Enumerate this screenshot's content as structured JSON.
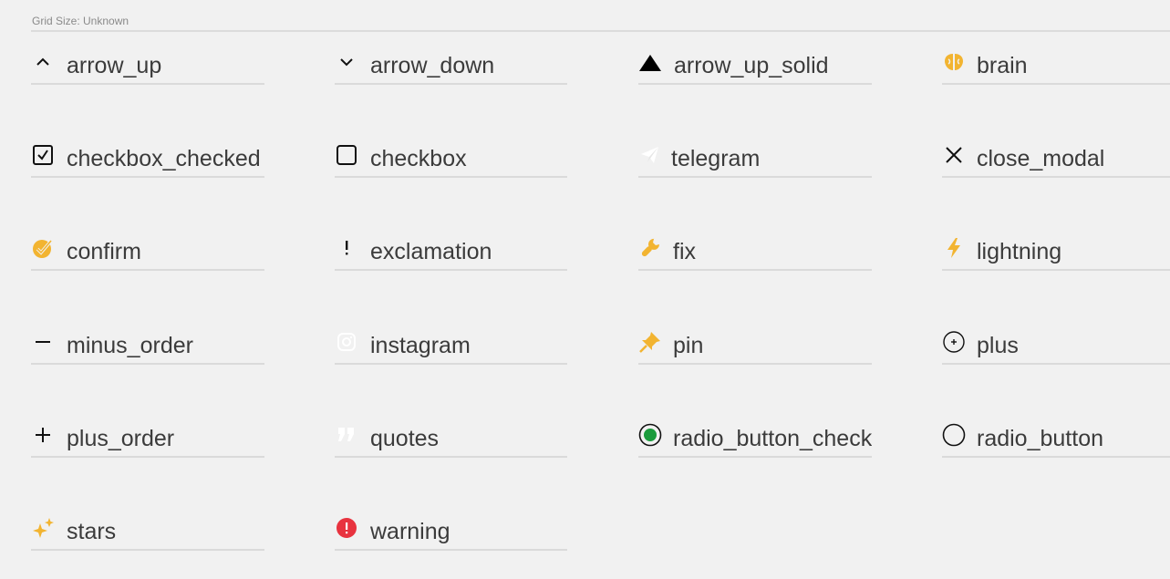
{
  "header": {
    "grid_size_text": "Grid Size: Unknown"
  },
  "colors": {
    "accent_yellow": "#f2b431",
    "radio_green": "#1a9b3c",
    "warning_red": "#e8333f",
    "text": "#3b3b3b"
  },
  "icons": [
    {
      "label": "arrow_up",
      "icon": "arrow-up-icon"
    },
    {
      "label": "arrow_down",
      "icon": "arrow-down-icon"
    },
    {
      "label": "arrow_up_solid",
      "icon": "arrow-up-solid-icon"
    },
    {
      "label": "brain",
      "icon": "brain-icon"
    },
    {
      "label": "checkbox_checked",
      "icon": "checkbox-checked-icon"
    },
    {
      "label": "checkbox",
      "icon": "checkbox-icon"
    },
    {
      "label": "telegram",
      "icon": "telegram-icon"
    },
    {
      "label": "close_modal",
      "icon": "close-icon"
    },
    {
      "label": "confirm",
      "icon": "confirm-icon"
    },
    {
      "label": "exclamation",
      "icon": "exclamation-icon"
    },
    {
      "label": "fix",
      "icon": "wrench-icon"
    },
    {
      "label": "lightning",
      "icon": "lightning-icon"
    },
    {
      "label": "minus_order",
      "icon": "minus-icon"
    },
    {
      "label": "instagram",
      "icon": "instagram-icon"
    },
    {
      "label": "pin",
      "icon": "pin-icon"
    },
    {
      "label": "plus",
      "icon": "plus-circle-icon"
    },
    {
      "label": "plus_order",
      "icon": "plus-icon"
    },
    {
      "label": "quotes",
      "icon": "quotes-icon"
    },
    {
      "label": "radio_button_checked",
      "icon": "radio-button-checked-icon"
    },
    {
      "label": "radio_button",
      "icon": "radio-button-icon"
    },
    {
      "label": "stars",
      "icon": "stars-icon"
    },
    {
      "label": "warning",
      "icon": "warning-icon"
    }
  ]
}
